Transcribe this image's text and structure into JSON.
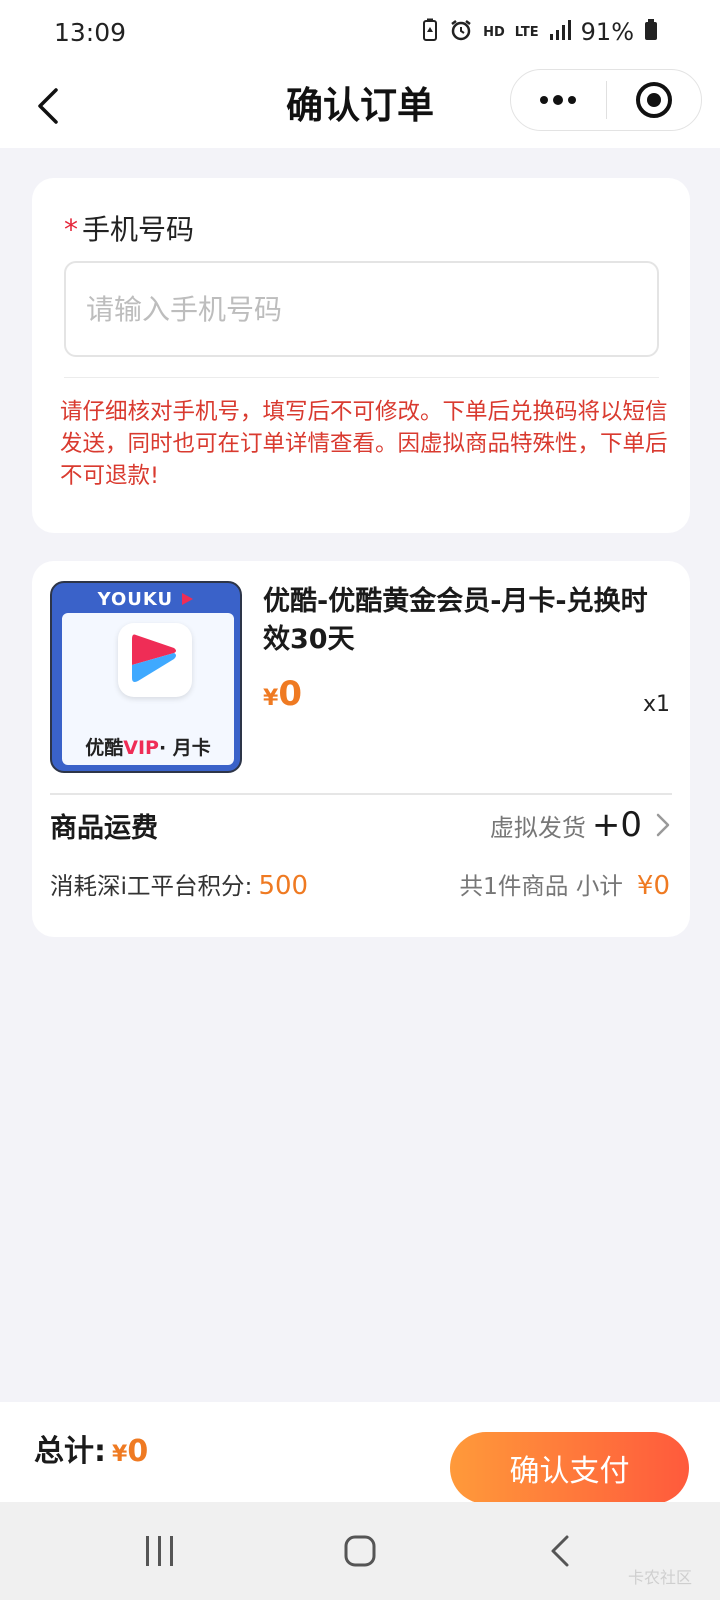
{
  "status_bar": {
    "time": "13:09",
    "network_label": "HD",
    "lte_label": "LTE",
    "battery": "91%"
  },
  "nav": {
    "title": "确认订单",
    "more_icon": "more-dots-icon",
    "target_icon": "record-target-icon"
  },
  "phone_form": {
    "required_mark": "*",
    "label": "手机号码",
    "placeholder": "请输入手机号码",
    "value": "",
    "warning": "请仔细核对手机号，填写后不可修改。下单后兑换码将以短信发送，同时也可在订单详情查看。因虚拟商品特殊性，下单后不可退款!"
  },
  "product": {
    "thumb_brand": "YOUKU",
    "thumb_name_prefix": "优酷",
    "thumb_name_vip": "VIP",
    "thumb_name_suffix": "· 月卡",
    "title": "优酷-优酷黄金会员-月卡-兑换时效30天",
    "currency": "¥",
    "price": "0",
    "quantity": "x1"
  },
  "shipping": {
    "label": "商品运费",
    "method": "虚拟发货",
    "fee": "+0"
  },
  "points": {
    "label": "消耗深i工平台积分:",
    "value": "500"
  },
  "subtotal": {
    "label": "共1件商品 小计",
    "amount": "¥0"
  },
  "bottom": {
    "total_label": "总计:",
    "currency": "¥",
    "total": "0",
    "pay_button": "确认支付"
  },
  "watermark": "卡农社区",
  "colors": {
    "accent_orange": "#ef7a22",
    "warning_red": "#d93a2f",
    "button_gradient_start": "#ff9a3a",
    "button_gradient_end": "#ff5a3c"
  }
}
